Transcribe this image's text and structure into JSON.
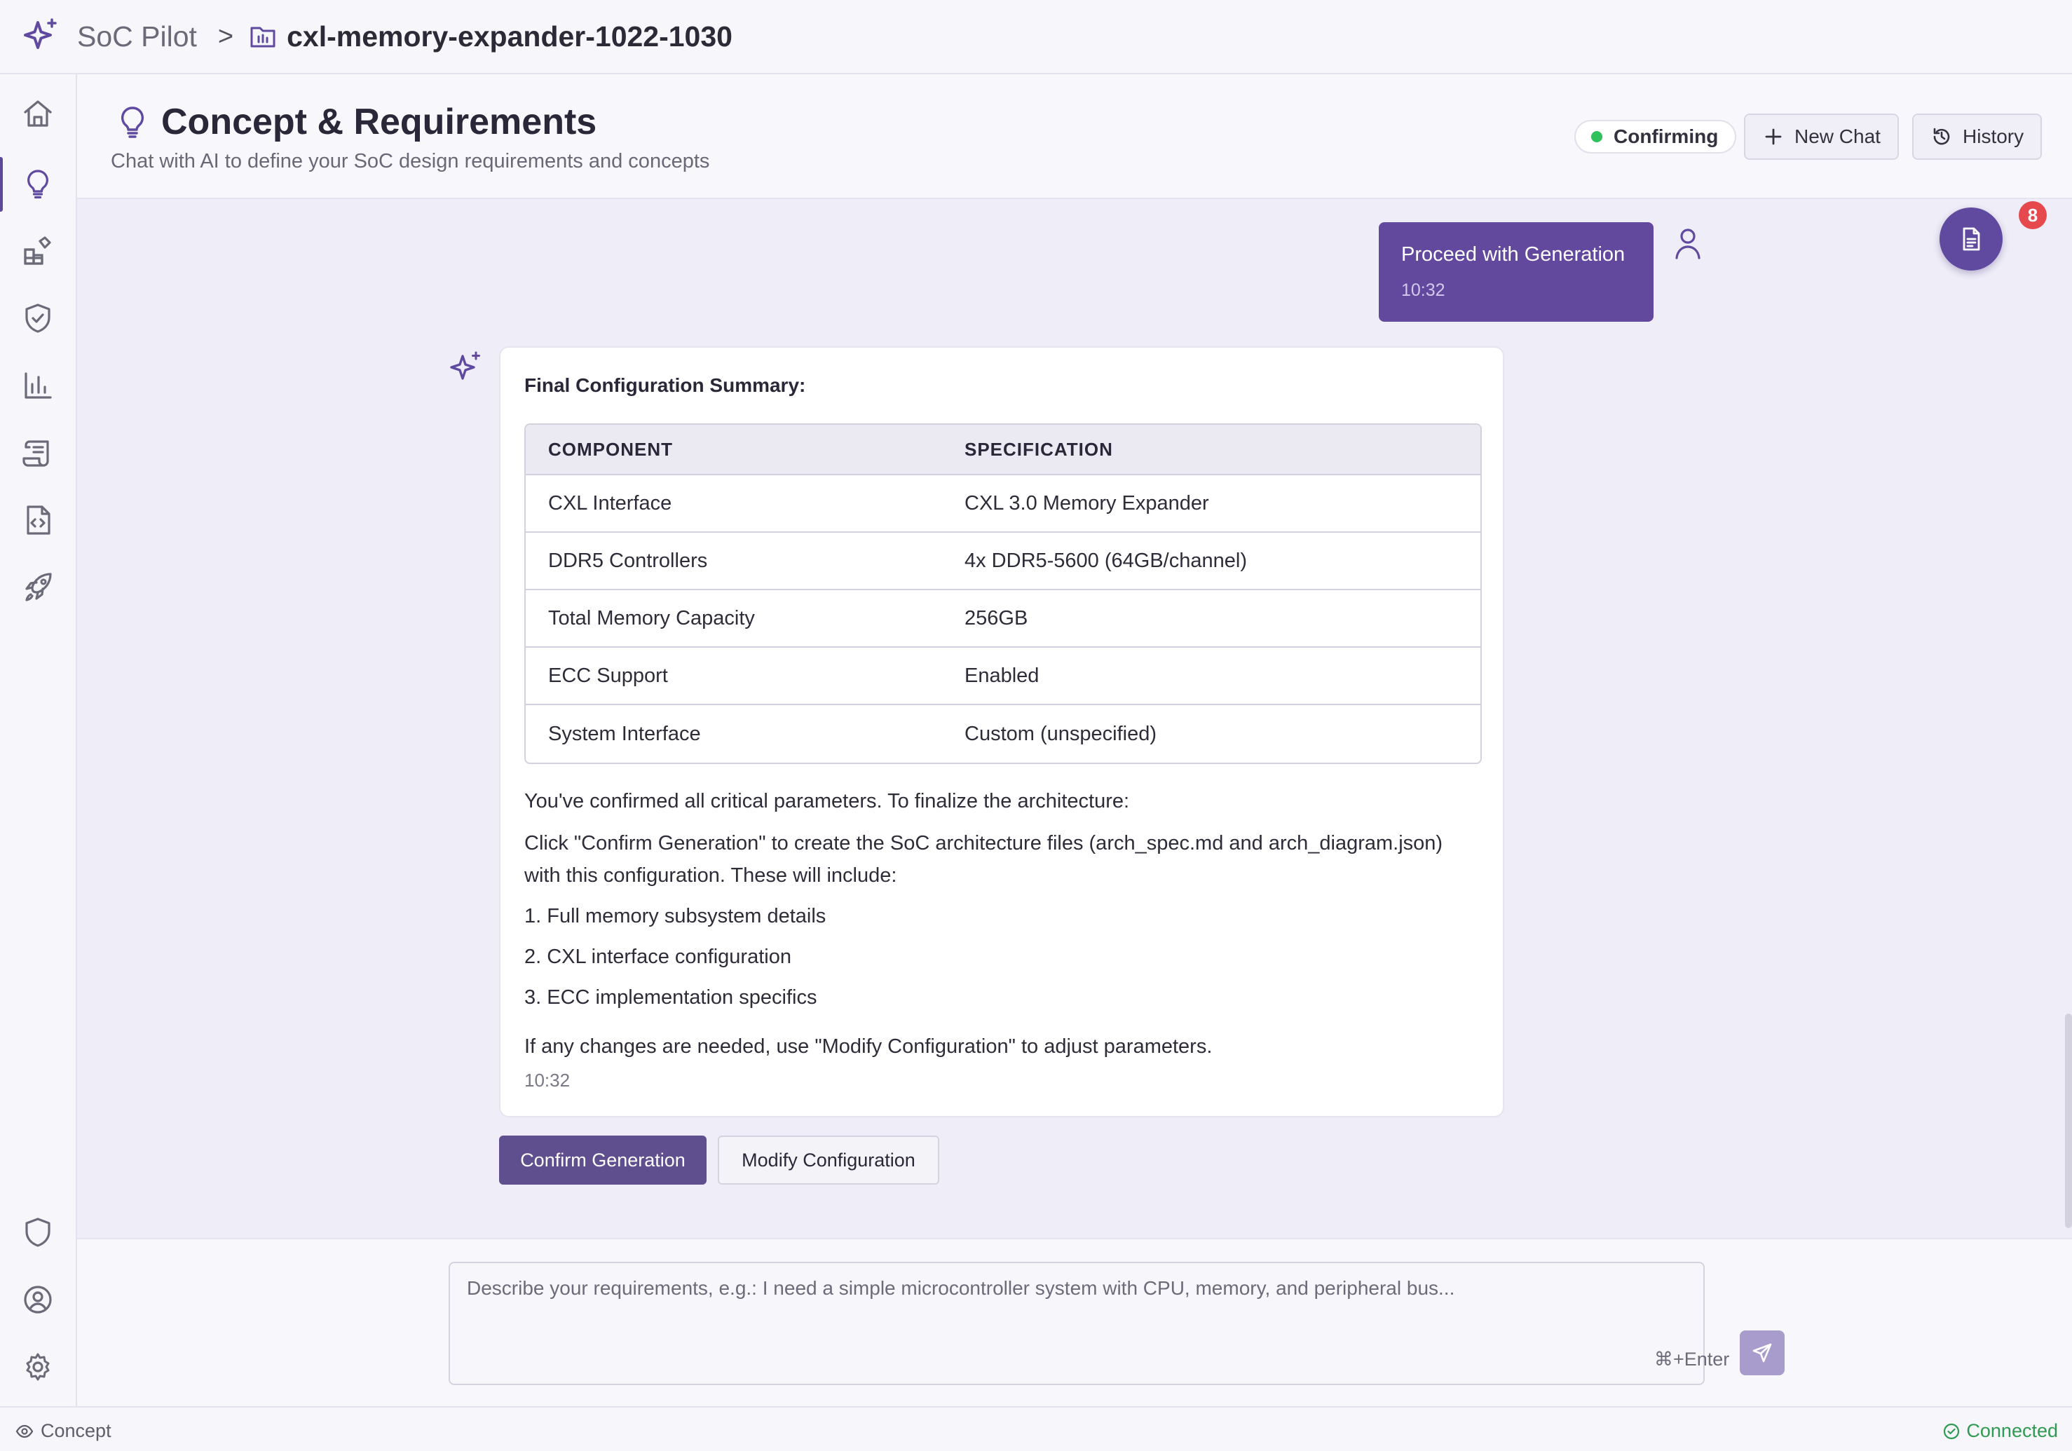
{
  "topbar": {
    "app_name": "SoC Pilot",
    "separator": ">",
    "project_name": "cxl-memory-expander-1022-1030"
  },
  "sidebar": {
    "items": [
      {
        "name": "home-icon"
      },
      {
        "name": "lightbulb-icon",
        "active": true
      },
      {
        "name": "blocks-icon"
      },
      {
        "name": "shield-check-icon"
      },
      {
        "name": "bar-chart-icon"
      },
      {
        "name": "scroll-icon"
      },
      {
        "name": "file-code-icon"
      },
      {
        "name": "rocket-icon"
      }
    ],
    "bottom_items": [
      {
        "name": "shield-icon"
      },
      {
        "name": "user-circle-icon"
      },
      {
        "name": "gear-icon"
      }
    ]
  },
  "header": {
    "title": "Concept & Requirements",
    "subtitle": "Chat with AI to define your SoC design requirements and concepts",
    "status": "Confirming",
    "new_chat_label": "New Chat",
    "history_label": "History"
  },
  "documents": {
    "badge_count": "8"
  },
  "user_message": {
    "text": "Proceed with Generation",
    "time": "10:32"
  },
  "ai_message": {
    "summary_title": "Final Configuration Summary:",
    "table": {
      "headers": [
        "COMPONENT",
        "SPECIFICATION"
      ],
      "rows": [
        [
          "CXL Interface",
          "CXL 3.0 Memory Expander"
        ],
        [
          "DDR5 Controllers",
          "4x DDR5-5600 (64GB/channel)"
        ],
        [
          "Total Memory Capacity",
          "256GB"
        ],
        [
          "ECC Support",
          "Enabled"
        ],
        [
          "System Interface",
          "Custom (unspecified)"
        ]
      ]
    },
    "para1": "You've confirmed all critical parameters. To finalize the architecture:",
    "para2": "Click \"Confirm Generation\" to create the SoC architecture files (arch_spec.md and arch_diagram.json) with this configuration. These will include:",
    "list": [
      "1. Full memory subsystem details",
      "2. CXL interface configuration",
      "3. ECC implementation specifics"
    ],
    "para3": "If any changes are needed, use \"Modify Configuration\" to adjust parameters.",
    "time": "10:32"
  },
  "actions": {
    "confirm_label": "Confirm Generation",
    "modify_label": "Modify Configuration"
  },
  "input": {
    "value": "",
    "placeholder": "Describe your requirements, e.g.: I need a simple microcontroller system with CPU, memory, and peripheral bus...",
    "shortcut": "⌘+Enter"
  },
  "statusbar": {
    "mode": "Concept",
    "connection": "Connected"
  },
  "colors": {
    "accent": "#5f4aa0",
    "user_bubble": "#62499e",
    "status_green": "#2fc15a",
    "badge_red": "#e5484d"
  }
}
